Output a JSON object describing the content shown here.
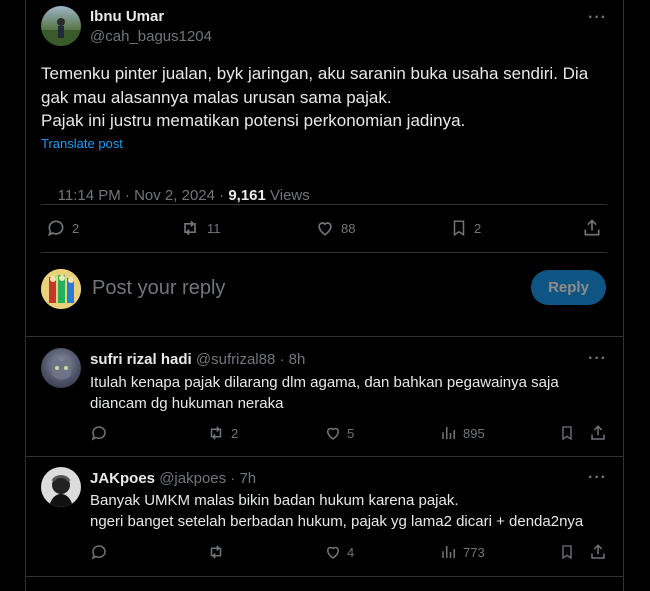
{
  "main_post": {
    "author_name": "Ibnu Umar",
    "handle": "@cah_bagus1204",
    "text_lines": [
      "Temenku pinter jualan,  byk jaringan, aku saranin buka usaha sendiri. Dia",
      "gak mau alasannya malas urusan sama pajak.",
      "Pajak ini justru mematikan potensi perkonomian jadinya."
    ],
    "translate_label": "Translate post",
    "timestamp": "11:14 PM · Nov 2, 2024 · ",
    "views_count": "9,161",
    "views_label": " Views",
    "reply_count": "2",
    "repost_count": "11",
    "like_count": "88",
    "bookmark_count": "2"
  },
  "composer": {
    "placeholder": "Post your reply",
    "reply_button_label": "Reply"
  },
  "replies": [
    {
      "author_name": "sufri rizal hadi",
      "handle_time": "@sufrizal88 · 8h",
      "text_lines": [
        "Itulah kenapa pajak dilarang dlm agama, dan bahkan pegawainya saja",
        "diancam dg hukuman neraka"
      ],
      "reply_count": "",
      "repost_count": "2",
      "like_count": "5",
      "views_count": "895"
    },
    {
      "author_name": "JAKpoes",
      "handle_time": "@jakpoes · 7h",
      "text_lines": [
        "Banyak UMKM malas bikin badan hukum karena pajak.",
        "ngeri banget setelah berbadan hukum, pajak yg lama2 dicari + denda2nya"
      ],
      "reply_count": "",
      "repost_count": "",
      "like_count": "4",
      "views_count": "773"
    }
  ],
  "more_label": "···",
  "colors": {
    "background": "#000000",
    "text": "#e7e9ea",
    "muted": "#71767b",
    "accent": "#1d9bf0",
    "border": "#2f3336"
  }
}
